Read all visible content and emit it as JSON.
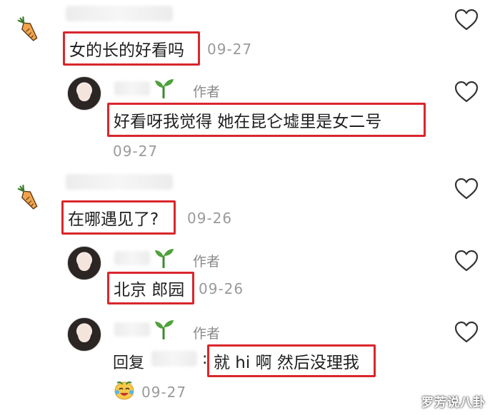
{
  "comments": [
    {
      "text": "女的长的好看吗",
      "time": "09-27",
      "reply": {
        "badge": "作者",
        "text": "好看呀我觉得 她在昆仑墟里是女二号",
        "time": "09-27"
      }
    },
    {
      "text": "在哪遇见了?",
      "time": "09-26",
      "replies": [
        {
          "badge": "作者",
          "text": "北京 郎园",
          "time": "09-26"
        },
        {
          "badge": "作者",
          "reply_prefix": "回复",
          "separator": ":",
          "text": "就 hi 啊 然后没理我",
          "time": "09-27"
        }
      ]
    }
  ],
  "watermark": "罗芳说八卦",
  "icons": {
    "heart": "heart-outline-icon",
    "carrot": "carrot-avatar-icon",
    "sprout": "sprout-icon",
    "reaction": "crying-laughing-emoji-icon"
  }
}
